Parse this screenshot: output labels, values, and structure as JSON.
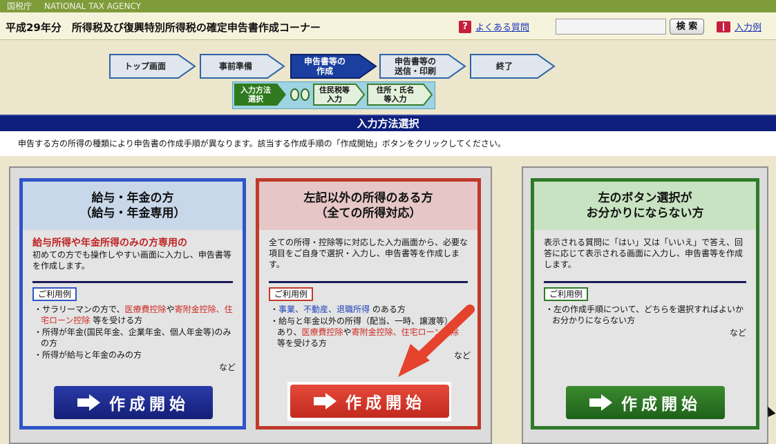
{
  "agency": {
    "jp": "国税庁",
    "en": "NATIONAL TAX AGENCY"
  },
  "header": {
    "title": "平成29年分　所得税及び復興特別所得税の確定申告書作成コーナー",
    "faq_label": "よくある質問",
    "search_placeholder": "",
    "search_button": "検 索",
    "example_label": "入力例"
  },
  "steps": [
    {
      "label": "トップ画面",
      "state": "done"
    },
    {
      "label": "事前準備",
      "state": "done"
    },
    {
      "label": "申告書等の\n作成",
      "state": "current"
    },
    {
      "label": "申告書等の\n送信・印刷",
      "state": "todo"
    },
    {
      "label": "終了",
      "state": "todo"
    }
  ],
  "substeps": [
    {
      "label": "入力方法\n選択",
      "state": "current"
    },
    {
      "label": "住民税等\n入力",
      "state": "todo"
    },
    {
      "label": "住所・氏名\n等入力",
      "state": "todo"
    }
  ],
  "section_title": "入力方法選択",
  "intro_text": "申告する方の所得の種類により申告書の作成手順が異なります。該当する作成手順の「作成開始」ボタンをクリックしてください。",
  "cards": [
    {
      "title1": "給与・年金の方",
      "title2": "（給与・年金専用）",
      "lead": "給与所得や年金所得のみの方専用の",
      "desc": "初めての方でも操作しやすい画面に入力し、申告書等を作成します。",
      "usage_label": "ご利用例",
      "more": "など",
      "button": "作成開始"
    },
    {
      "title1": "左記以外の所得のある方",
      "title2": "（全ての所得対応）",
      "desc": "全ての所得・控除等に対応した入力画面から、必要な項目をご自身で選択・入力し、申告書等を作成します。",
      "usage_label": "ご利用例",
      "more": "など",
      "button": "作成開始"
    },
    {
      "title1": "左のボタン選択が",
      "title2": "お分かりにならない方",
      "desc": "表示される質問に「はい」又は「いいえ」で答え、回答に応じて表示される画面に入力し、申告書等を作成します。",
      "usage_label": "ご利用例",
      "item": "左の作成手順について、どちらを選択すればよいかお分かりにならない方",
      "more": "など",
      "button": "作成開始"
    }
  ],
  "card1_items": {
    "i1a": "サラリーマンの方で、",
    "i1b": "医療費控除",
    "i1c": "や",
    "i1d": "寄附金控除",
    "i1e": "、",
    "i1f": "住宅ローン控除",
    "i1g": " 等を受ける方",
    "i2": "所得が年金(国民年金、企業年金、個人年金等)のみの方",
    "i3": "所得が給与と年金のみの方"
  },
  "card2_items": {
    "i1a": "事業",
    "i1b": "、",
    "i1c": "不動産",
    "i1d": "、",
    "i1e": "退職所得",
    "i1f": " のある方",
    "i2a": "給与と年金以外の所得（配当、一時、譲渡等）があり、",
    "i2b": "医療費控除",
    "i2c": "や",
    "i2d": "寄附金控除",
    "i2e": "、",
    "i2f": "住宅ローン控除",
    "i2g": " 等を受ける方"
  },
  "colors": {
    "blue_card": "#2f55c8",
    "red_card": "#c0392b",
    "green_card": "#2f7a2a"
  }
}
